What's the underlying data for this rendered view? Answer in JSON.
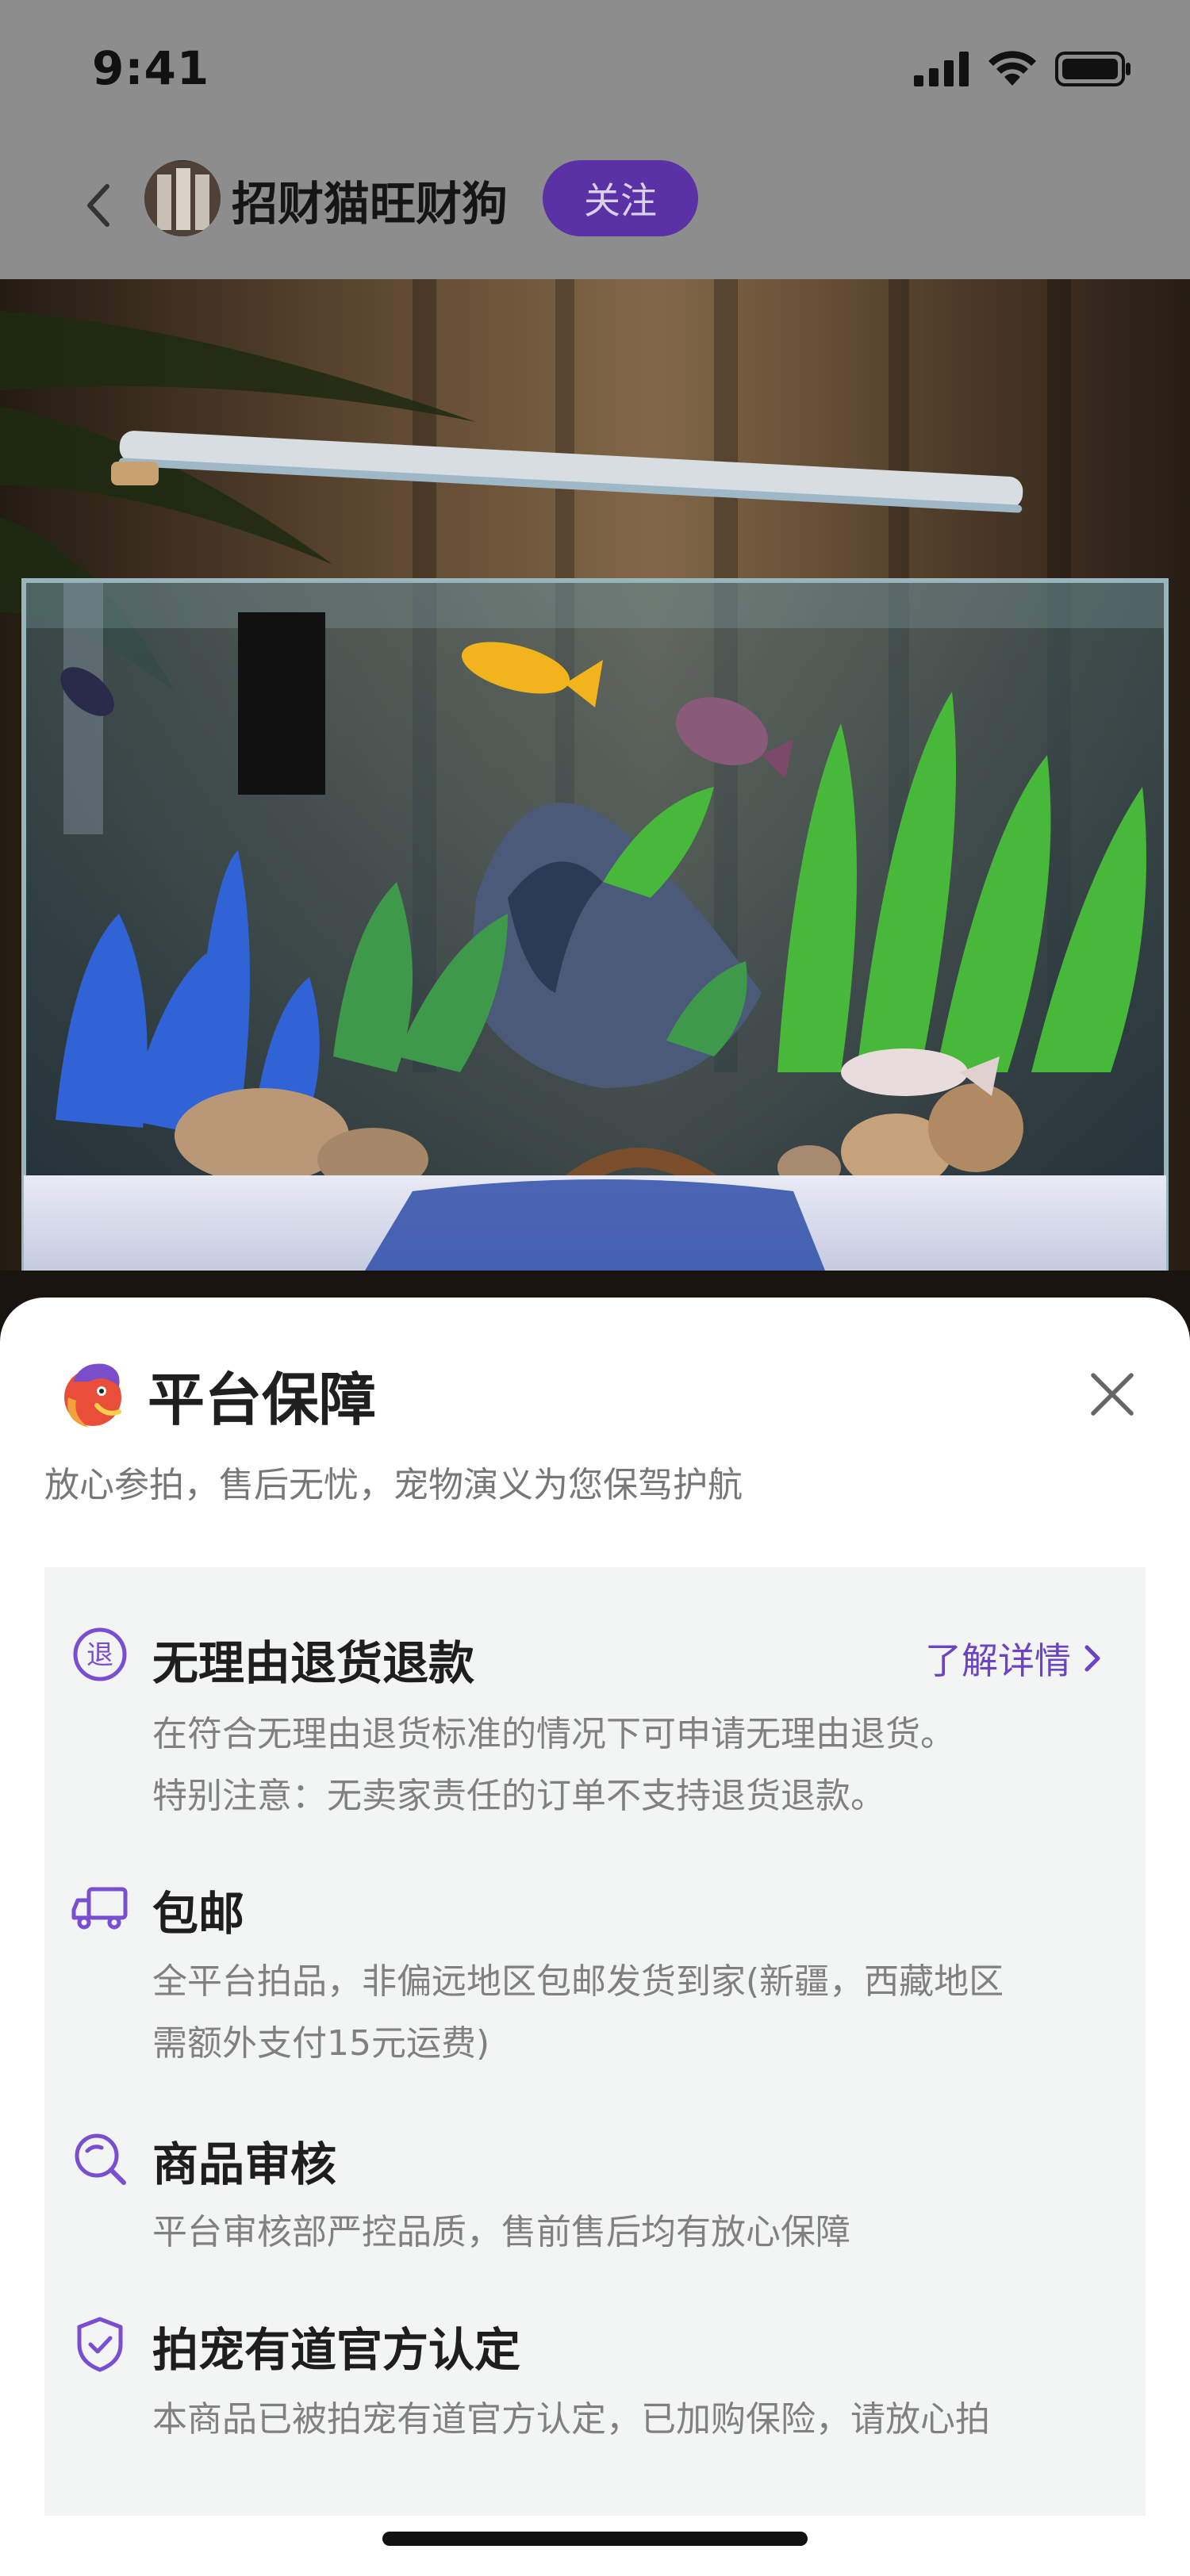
{
  "status_bar": {
    "time": "9:41"
  },
  "nav": {
    "shop_name": "招财猫旺财狗",
    "follow_label": "关注"
  },
  "sheet": {
    "title": "平台保障",
    "subtitle": "放心参拍，售后无忧，宠物演义为您保驾护航",
    "items": [
      {
        "icon": "return-icon",
        "title": "无理由退货退款",
        "link": "了解详情",
        "lines": [
          "在符合无理由退货标准的情况下可申请无理由退货。",
          "特别注意：无卖家责任的订单不支持退货退款。"
        ]
      },
      {
        "icon": "truck-icon",
        "title": "包邮",
        "lines": [
          "全平台拍品，非偏远地区包邮发货到家(新疆，西藏地区",
          "需额外支付15元运费)"
        ]
      },
      {
        "icon": "search-icon",
        "title": "商品审核",
        "lines": [
          "平台审核部严控品质，售前售后均有放心保障"
        ]
      },
      {
        "icon": "shield-check-icon",
        "title": "拍宠有道官方认定",
        "lines": [
          "本商品已被拍宠有道官方认定，已加购保险，请放心拍"
        ]
      }
    ]
  },
  "colors": {
    "accent": "#6b43c4",
    "follow_bg": "#5a32a6",
    "overlay": "#8d8d8d"
  }
}
